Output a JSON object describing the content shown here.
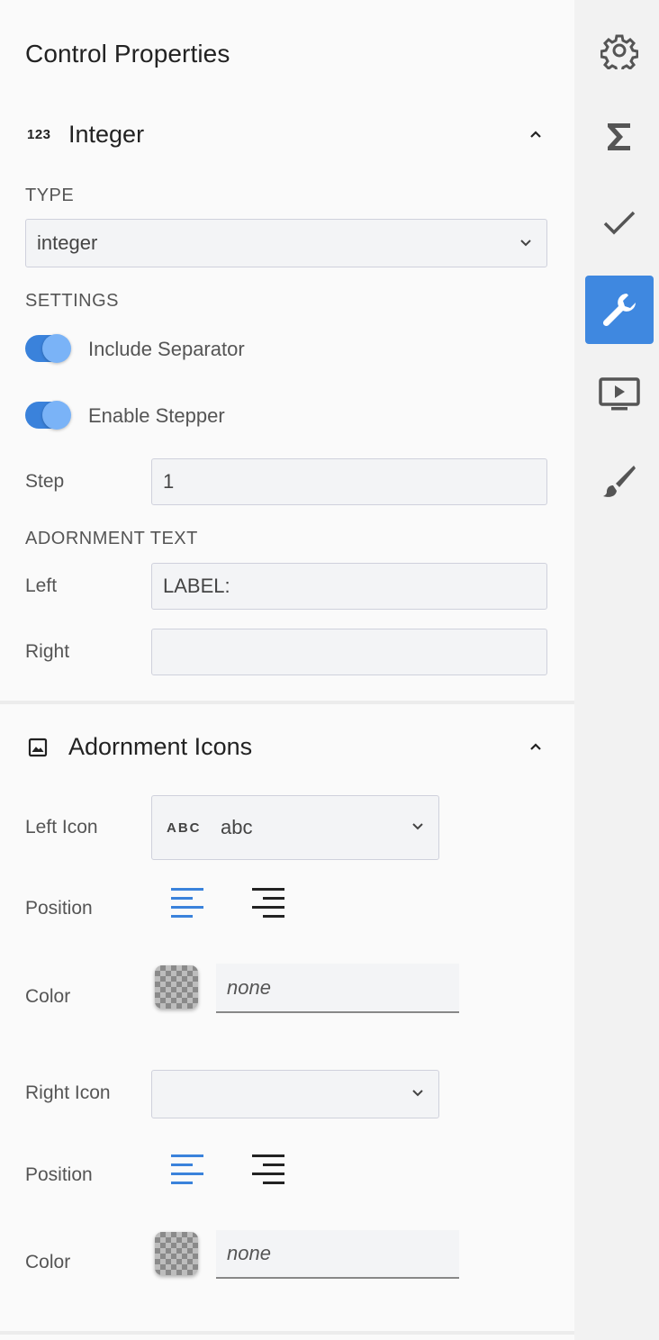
{
  "panel": {
    "title": "Control Properties"
  },
  "integer_section": {
    "icon_text": "123",
    "title": "Integer",
    "type_label": "TYPE",
    "type_value": "integer",
    "settings_label": "SETTINGS",
    "include_separator_label": "Include Separator",
    "include_separator_on": true,
    "enable_stepper_label": "Enable Stepper",
    "enable_stepper_on": true,
    "step_label": "Step",
    "step_value": "1",
    "adornment_text_label": "ADORNMENT TEXT",
    "left_label": "Left",
    "left_value": "LABEL:",
    "right_label": "Right",
    "right_value": ""
  },
  "icons_section": {
    "title": "Adornment Icons",
    "left_icon_label": "Left Icon",
    "left_icon_glyph": "ABC",
    "left_icon_value": "abc",
    "left_position_label": "Position",
    "left_color_label": "Color",
    "left_color_value": "none",
    "right_icon_label": "Right Icon",
    "right_icon_value": "",
    "right_position_label": "Position",
    "right_color_label": "Color",
    "right_color_value": "none"
  },
  "colors": {
    "accent": "#3f88e0",
    "toggle_track": "#3a82db",
    "toggle_knob": "#7ab3f7",
    "align_left_active": "#3a82db",
    "align_right_inactive": "#222222"
  },
  "rail": {
    "items": [
      {
        "icon": "gear-icon",
        "active": false
      },
      {
        "icon": "sigma-icon",
        "active": false
      },
      {
        "icon": "check-icon",
        "active": false
      },
      {
        "icon": "wrench-icon",
        "active": true
      },
      {
        "icon": "preview-icon",
        "active": false
      },
      {
        "icon": "brush-icon",
        "active": false
      }
    ]
  }
}
